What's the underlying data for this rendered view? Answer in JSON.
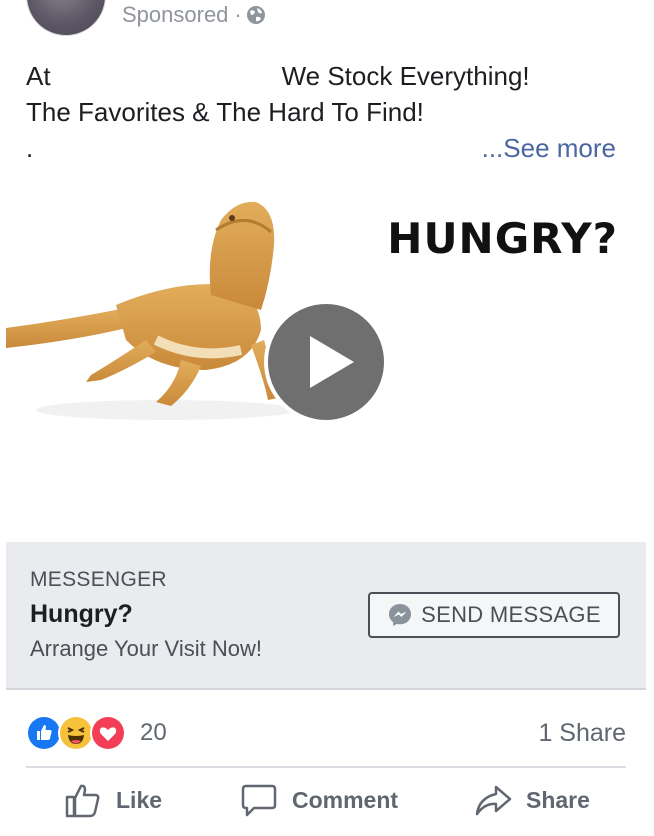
{
  "header": {
    "sponsored_label": "Sponsored",
    "separator": "·",
    "privacy_icon": "globe-icon"
  },
  "body": {
    "line1_start": "At",
    "line1_end": "We Stock Everything!",
    "line2": "The Favorites & The Hard To Find!",
    "line3": ".",
    "see_more": "...See more"
  },
  "media": {
    "overlay_text": "HUNGRY?",
    "play_icon": "play-icon"
  },
  "cta": {
    "source": "MESSENGER",
    "title": "Hungry?",
    "subtitle": "Arrange Your Visit Now!",
    "button_label": "SEND MESSAGE",
    "button_icon": "messenger-icon"
  },
  "engagement": {
    "reaction_icons": [
      "like-reaction-icon",
      "haha-reaction-icon",
      "love-reaction-icon"
    ],
    "reaction_count": "20",
    "share_count": "1 Share"
  },
  "actions": {
    "like": "Like",
    "comment": "Comment",
    "share": "Share"
  },
  "colors": {
    "link_blue": "#4b67a1",
    "cta_background": "#e9ebee",
    "like_blue": "#1877f2",
    "love_red": "#f33e58",
    "haha_yellow": "#f7c23b"
  }
}
